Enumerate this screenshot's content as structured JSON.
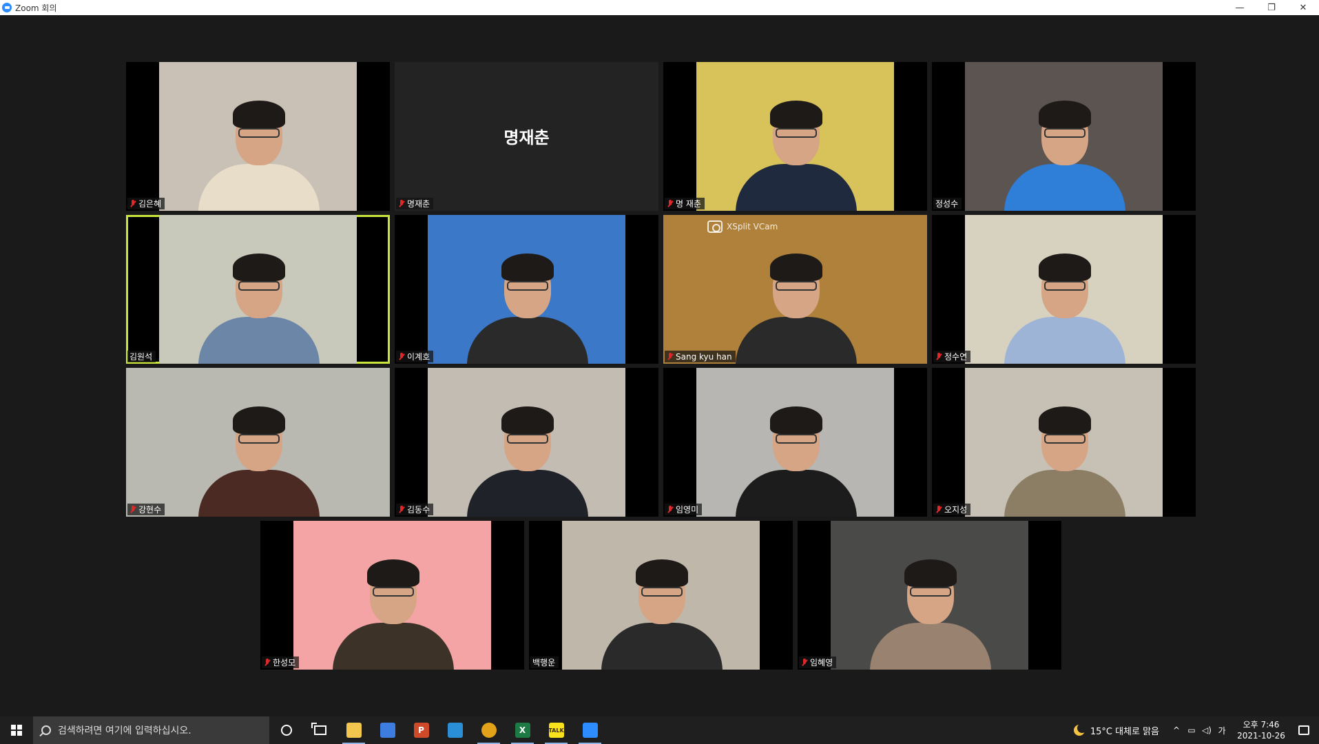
{
  "window": {
    "title": "Zoom 회의",
    "controls": [
      "—",
      "❐",
      "✕"
    ]
  },
  "participants": [
    {
      "name": "김은혜",
      "muted": true,
      "video": true,
      "bg": "#c9c0b6",
      "shirt": "#e8ddc8"
    },
    {
      "name": "명재춘",
      "muted": true,
      "video": false,
      "bg": "#232323",
      "shirt": "#232323"
    },
    {
      "name": "명 재춘",
      "muted": true,
      "video": true,
      "bg": "#d8c25a",
      "shirt": "#1f2a3e"
    },
    {
      "name": "정성수",
      "muted": false,
      "video": true,
      "bg": "#5b5450",
      "shirt": "#2f7ed8"
    },
    {
      "name": "김원석",
      "muted": false,
      "video": true,
      "speaking": true,
      "bg": "#c9c9bb",
      "shirt": "#6c86a8"
    },
    {
      "name": "이계호",
      "muted": true,
      "video": true,
      "bg": "#3c78c8",
      "shirt": "#2a2a2a"
    },
    {
      "name": "Sang kyu han",
      "muted": true,
      "video": true,
      "watermark": "XSplit VCam",
      "bg": "#b0813a",
      "shirt": "#2a2a2a"
    },
    {
      "name": "정수연",
      "muted": true,
      "video": true,
      "bg": "#d7d1c0",
      "shirt": "#9db4d6"
    },
    {
      "name": "강현수",
      "muted": true,
      "video": true,
      "bg": "#b9b9b2",
      "shirt": "#4a2a22"
    },
    {
      "name": "김동수",
      "muted": true,
      "video": true,
      "bg": "#c2bcb2",
      "shirt": "#1f2228"
    },
    {
      "name": "임영미",
      "muted": true,
      "video": true,
      "bg": "#b8b6b3",
      "shirt": "#1c1c1c"
    },
    {
      "name": "오지성",
      "muted": true,
      "video": true,
      "bg": "#c7c1b5",
      "shirt": "#8c7e64"
    },
    {
      "name": "한성모",
      "muted": true,
      "video": true,
      "bg": "#f4a4a4",
      "shirt": "#3c3228"
    },
    {
      "name": "백행운",
      "muted": false,
      "video": true,
      "bg": "#bfb7aa",
      "shirt": "#2a2a2a"
    },
    {
      "name": "임혜영",
      "muted": true,
      "video": true,
      "bg": "#4a4a48",
      "shirt": "#9a8270"
    }
  ],
  "taskbar": {
    "search_placeholder": "검색하려면 여기에 입력하십시오.",
    "apps": [
      {
        "name": "file-explorer",
        "label": "",
        "color": "#f3c64e",
        "active": true
      },
      {
        "name": "store",
        "label": "",
        "color": "#3d7de0",
        "active": false
      },
      {
        "name": "powerpoint",
        "label": "P",
        "color": "#d04a2a",
        "active": false
      },
      {
        "name": "hancom",
        "label": "",
        "color": "#2a8fd6",
        "active": false
      },
      {
        "name": "chrome",
        "label": "",
        "color": "#e2a21a",
        "active": true
      },
      {
        "name": "excel",
        "label": "X",
        "color": "#1e7a44",
        "active": true
      },
      {
        "name": "kakaotalk",
        "label": "TALK",
        "color": "#f7e21b",
        "active": true
      },
      {
        "name": "zoom",
        "label": "",
        "color": "#2d8cff",
        "active": true
      }
    ],
    "tray": {
      "weather": "15°C 대체로 맑음",
      "chevron": "^",
      "ime": "가",
      "time": "오후 7:46",
      "date": "2021-10-26"
    }
  }
}
